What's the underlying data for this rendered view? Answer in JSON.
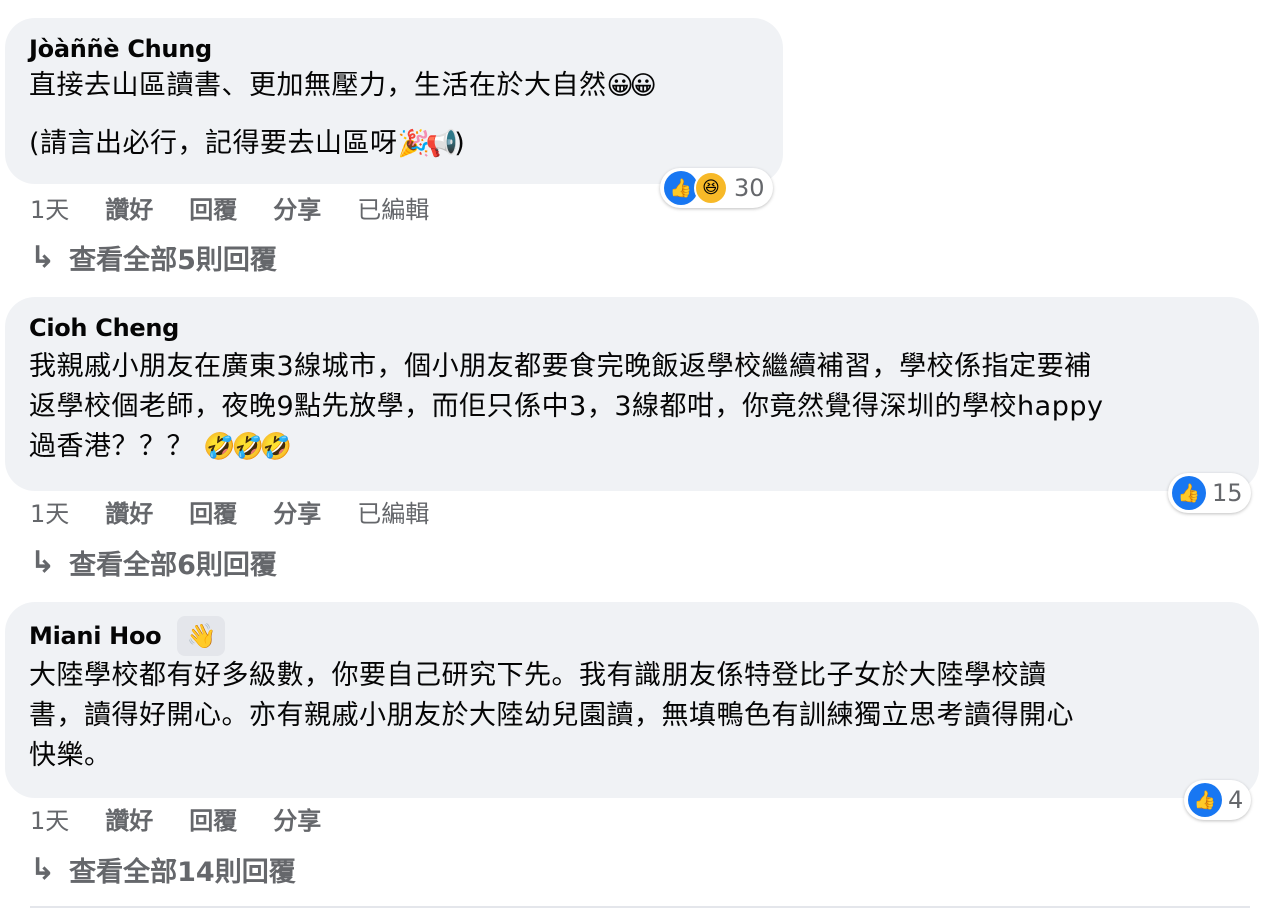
{
  "comments": [
    {
      "author": "Jòàññè Chung",
      "lines": [
        "直接去山區讀書、更加無壓力，生活在於大自然",
        "(請言出必行，記得要去山區呀"
      ],
      "emoji_line1": "😀😀",
      "emoji_line2": "🎉📢",
      "line2_suffix": ")",
      "reaction_count": "30",
      "time": "1天",
      "like_label": "讚好",
      "reply_label": "回覆",
      "share_label": "分享",
      "edited_label": "已編輯",
      "view_replies": "查看全部5則回覆"
    },
    {
      "author": "Cioh Cheng",
      "lines": [
        "我親戚小朋友在廣東3線城市，個小朋友都要食完晚飯返學校繼續補習，學校係指定要補",
        "返學校個老師，夜晚9點先放學，而佢只係中3，3線都咁，你竟然覺得深圳的學校happy",
        "過香港？？？"
      ],
      "emoji_line3": "🤣🤣🤣",
      "reaction_count": "15",
      "time": "1天",
      "like_label": "讚好",
      "reply_label": "回覆",
      "share_label": "分享",
      "edited_label": "已編輯",
      "view_replies": "查看全部6則回覆"
    },
    {
      "author": "Miani Hoo",
      "badge_icon": "waving-hand",
      "lines": [
        "大陸學校都有好多級數，你要自己研究下先。我有識朋友係特登比子女於大陸學校讀",
        "書，讀得好開心。亦有親戚小朋友於大陸幼兒園讀，無填鴨色有訓練獨立思考讀得開心",
        "快樂。"
      ],
      "reaction_count": "4",
      "time": "1天",
      "like_label": "讚好",
      "reply_label": "回覆",
      "share_label": "分享",
      "view_replies": "查看全部14則回覆"
    }
  ]
}
